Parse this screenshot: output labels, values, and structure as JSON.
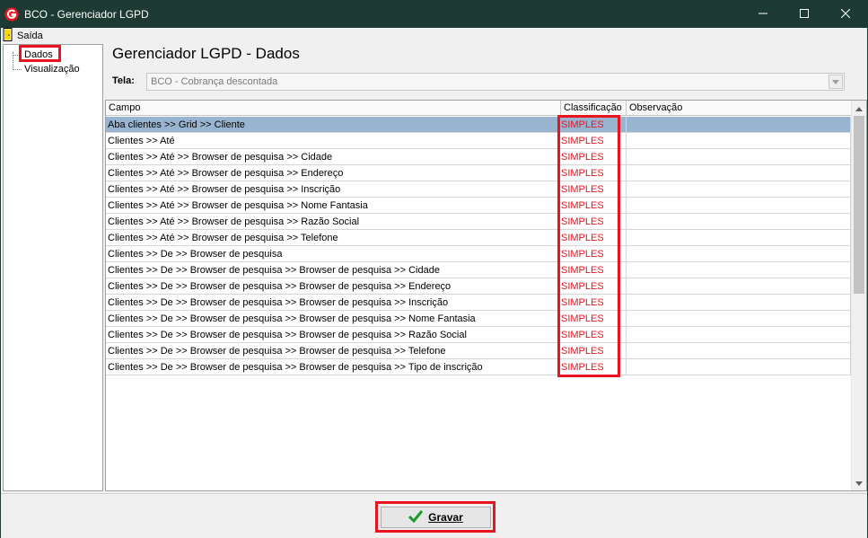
{
  "window": {
    "title": "BCO - Gerenciador LGPD",
    "controls": [
      "minimize-icon",
      "maximize-icon",
      "close-icon"
    ],
    "title_bar_color": "#1e3b33"
  },
  "menu": {
    "exit_label": "Saída"
  },
  "tree": {
    "items": [
      {
        "label": "Dados"
      },
      {
        "label": "Visualização"
      }
    ]
  },
  "main": {
    "heading": "Gerenciador LGPD - Dados",
    "tela_label": "Tela:",
    "tela_value": "BCO - Cobrança descontada"
  },
  "grid": {
    "columns": [
      "Campo",
      "Classificação",
      "Observação"
    ],
    "rows": [
      {
        "campo": "Aba clientes >> Grid >> Cliente",
        "classificacao": "SIMPLES",
        "observacao": ""
      },
      {
        "campo": "Clientes >> Até",
        "classificacao": "SIMPLES",
        "observacao": ""
      },
      {
        "campo": "Clientes >> Até  >> Browser de pesquisa >> Cidade",
        "classificacao": "SIMPLES",
        "observacao": ""
      },
      {
        "campo": "Clientes >> Até  >> Browser de pesquisa >> Endereço",
        "classificacao": "SIMPLES",
        "observacao": ""
      },
      {
        "campo": "Clientes >> Até  >> Browser de pesquisa >> Inscrição",
        "classificacao": "SIMPLES",
        "observacao": ""
      },
      {
        "campo": "Clientes >> Até  >> Browser de pesquisa >> Nome Fantasia",
        "classificacao": "SIMPLES",
        "observacao": ""
      },
      {
        "campo": "Clientes >> Até  >> Browser de pesquisa >> Razão Social",
        "classificacao": "SIMPLES",
        "observacao": ""
      },
      {
        "campo": "Clientes >> Até  >> Browser de pesquisa >> Telefone",
        "classificacao": "SIMPLES",
        "observacao": ""
      },
      {
        "campo": "Clientes >> De >> Browser de pesquisa",
        "classificacao": "SIMPLES",
        "observacao": ""
      },
      {
        "campo": "Clientes >> De >> Browser de pesquisa >> Browser de pesquisa >> Cidade",
        "classificacao": "SIMPLES",
        "observacao": ""
      },
      {
        "campo": "Clientes >> De >> Browser de pesquisa >> Browser de pesquisa >> Endereço",
        "classificacao": "SIMPLES",
        "observacao": ""
      },
      {
        "campo": "Clientes >> De >> Browser de pesquisa >> Browser de pesquisa >> Inscrição",
        "classificacao": "SIMPLES",
        "observacao": ""
      },
      {
        "campo": "Clientes >> De >> Browser de pesquisa >> Browser de pesquisa >> Nome Fantasia",
        "classificacao": "SIMPLES",
        "observacao": ""
      },
      {
        "campo": "Clientes >> De >> Browser de pesquisa >> Browser de pesquisa >> Razão Social",
        "classificacao": "SIMPLES",
        "observacao": ""
      },
      {
        "campo": "Clientes >> De >> Browser de pesquisa >> Browser de pesquisa >> Telefone",
        "classificacao": "SIMPLES",
        "observacao": ""
      },
      {
        "campo": "Clientes >> De >> Browser de pesquisa >> Browser de pesquisa >> Tipo de inscrição",
        "classificacao": "SIMPLES",
        "observacao": ""
      }
    ],
    "selected_row": 0,
    "selection_color": "#99b4d1",
    "classification_color": "#e8141f"
  },
  "footer": {
    "save_label": "Gravar",
    "save_icon": "checkmark-icon"
  },
  "highlight_color": "#e8141f"
}
